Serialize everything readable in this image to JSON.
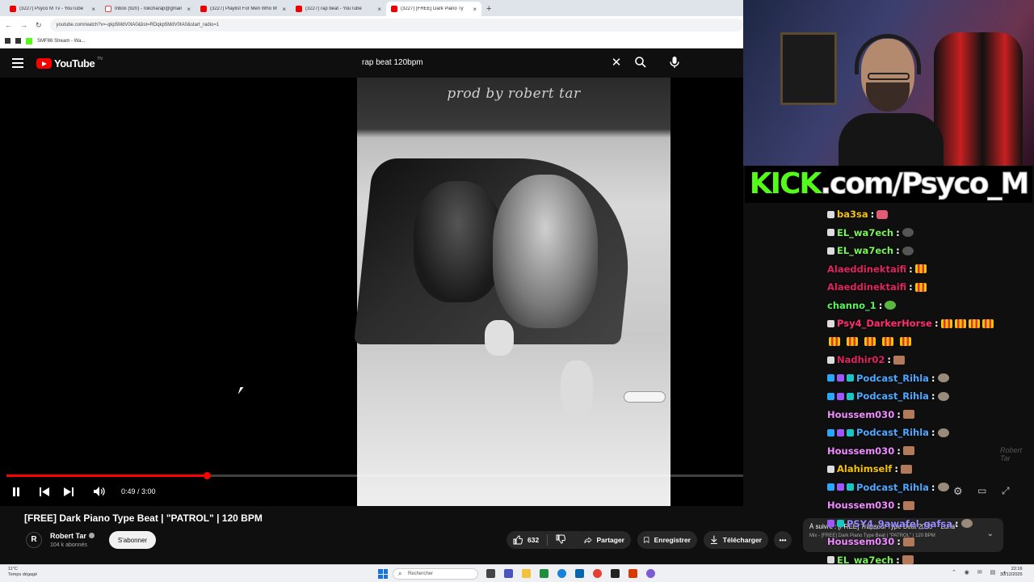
{
  "browser": {
    "tabs": [
      {
        "label": "(3227) Psyco M Tv - YouTube",
        "icon": "youtube-icon"
      },
      {
        "label": "Inbox (920) - rokcharap@gmail",
        "icon": "gmail-icon"
      },
      {
        "label": "(3227) Playlist For Men Who M",
        "icon": "youtube-icon"
      },
      {
        "label": "(3227) rap beat - YouTube",
        "icon": "youtube-icon"
      },
      {
        "label": "(3227) [FREE] Dark Piano Ty",
        "icon": "youtube-icon",
        "active": true
      }
    ],
    "new_tab": "+",
    "url": "youtube.com/watch?v=-qkp5MdV0tA0&list=RDqkp5MdV0tA0&start_radio=1",
    "bookmark": "SMF86 Stream - Wa..."
  },
  "youtube": {
    "logo_text": "YouTube",
    "logo_suffix": "TN",
    "search_value": "rap beat 120bpm",
    "video": {
      "art_credit": "prod by robert tar",
      "time": "0:49 / 3:00",
      "progress": 0.272,
      "title": "[FREE] Dark Piano Type Beat | \"PATROL\" | 120 BPM",
      "watermark": "Robert Tar"
    },
    "channel": {
      "avatar_letter": "R",
      "name": "Robert Tar",
      "subscribers": "104 k abonnés",
      "subscribe_label": "S'abonner"
    },
    "actions": {
      "likes": "632",
      "share": "Partager",
      "save": "Enregistrer",
      "download": "Télécharger"
    },
    "up_next": {
      "title": "À suivre : [FREE] Trapsoul Type Beat 2025 - \"Luna\"",
      "subtitle": "Mix - [FREE] Dark Piano Type Beat | \"PATROL\" | 120 BPM"
    }
  },
  "overlay": {
    "kick_logo": "KICK",
    "kick_rest": ".com/Psyco_M",
    "chat": [
      {
        "badges": [
          "white"
        ],
        "user": "ba3sa",
        "color": "#f5c400",
        "emotes": [
          "heart"
        ]
      },
      {
        "badges": [
          "white"
        ],
        "user": "EL_wa7ech",
        "color": "#7cf25a",
        "emotes": [
          "dark"
        ]
      },
      {
        "badges": [
          "white"
        ],
        "user": "EL_wa7ech",
        "color": "#7cf25a",
        "emotes": [
          "dark"
        ]
      },
      {
        "badges": [],
        "user": "Alaeddinektaifi",
        "color": "#e0245e",
        "emotes": [
          "bar"
        ]
      },
      {
        "badges": [],
        "user": "Alaeddinektaifi",
        "color": "#e0245e",
        "emotes": [
          "bar"
        ]
      },
      {
        "badges": [],
        "user": "channo_1",
        "color": "#5af25a",
        "emotes": [
          "frog"
        ]
      },
      {
        "badges": [
          "white"
        ],
        "user": "Psy4_DarkerHorse",
        "color": "#ff2f6f",
        "emotes": [
          "bar",
          "bar",
          "bar",
          "bar"
        ]
      },
      {
        "badges": [],
        "user": "",
        "color": "#fff",
        "emotes": [
          "bar",
          "bar",
          "bar",
          "bar",
          "bar"
        ],
        "continuation": true
      },
      {
        "badges": [
          "white"
        ],
        "user": "Nadhir02",
        "color": "#e0245e",
        "emotes": [
          "face"
        ]
      },
      {
        "badges": [
          "cyan",
          "purple",
          "teal"
        ],
        "user": "Podcast_Rihla",
        "color": "#4fa8ff",
        "emotes": [
          "cat"
        ]
      },
      {
        "badges": [
          "cyan",
          "purple",
          "teal"
        ],
        "user": "Podcast_Rihla",
        "color": "#4fa8ff",
        "emotes": [
          "cat"
        ]
      },
      {
        "badges": [],
        "user": "Houssem030",
        "color": "#f08cff",
        "emotes": [
          "face"
        ]
      },
      {
        "badges": [
          "cyan",
          "purple",
          "teal"
        ],
        "user": "Podcast_Rihla",
        "color": "#4fa8ff",
        "emotes": [
          "cat"
        ]
      },
      {
        "badges": [],
        "user": "Houssem030",
        "color": "#f08cff",
        "emotes": [
          "face"
        ]
      },
      {
        "badges": [
          "white"
        ],
        "user": "Alahimself",
        "color": "#f5c400",
        "emotes": [
          "face"
        ]
      },
      {
        "badges": [
          "cyan",
          "purple",
          "teal"
        ],
        "user": "Podcast_Rihla",
        "color": "#4fa8ff",
        "emotes": [
          "cat"
        ]
      },
      {
        "badges": [],
        "user": "Houssem030",
        "color": "#f08cff",
        "emotes": [
          "face"
        ]
      },
      {
        "badges": [
          "purple",
          "teal"
        ],
        "user": "PSY4_9awafel_gafsa",
        "color": "#9b8cff",
        "emotes": [
          "cat"
        ]
      },
      {
        "badges": [],
        "user": "Houssem030",
        "color": "#f08cff",
        "emotes": [
          "face"
        ]
      },
      {
        "badges": [
          "white"
        ],
        "user": "EL_wa7ech",
        "color": "#7cf25a",
        "emotes": [
          "face"
        ]
      }
    ]
  },
  "taskbar": {
    "weather_temp": "11°C",
    "weather_desc": "Temps dégagé",
    "search_placeholder": "Rechercher",
    "time": "22:16",
    "date": "30/12/2025"
  },
  "colors": {
    "yt_red": "#ff0000",
    "kick_green": "#53fc18",
    "yt_bg": "#0f0f0f"
  }
}
